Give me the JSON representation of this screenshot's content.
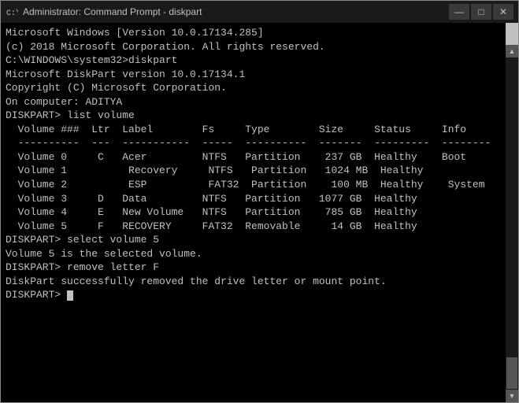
{
  "window": {
    "title": "Administrator: Command Prompt - diskpart",
    "icon": "cmd"
  },
  "titlebar": {
    "minimize_label": "—",
    "maximize_label": "□",
    "close_label": "✕"
  },
  "terminal": {
    "lines": [
      "Microsoft Windows [Version 10.0.17134.285]",
      "(c) 2018 Microsoft Corporation. All rights reserved.",
      "",
      "C:\\WINDOWS\\system32>diskpart",
      "",
      "Microsoft DiskPart version 10.0.17134.1",
      "",
      "Copyright (C) Microsoft Corporation.",
      "On computer: ADITYA",
      "",
      "DISKPART> list volume",
      "",
      "  Volume ###  Ltr  Label        Fs     Type        Size     Status     Info",
      "  ----------  ---  -----------  -----  ----------  -------  ---------  --------",
      "  Volume 0     C   Acer         NTFS   Partition    237 GB  Healthy    Boot",
      "  Volume 1          Recovery     NTFS   Partition   1024 MB  Healthy",
      "  Volume 2          ESP          FAT32  Partition    100 MB  Healthy    System",
      "  Volume 3     D   Data         NTFS   Partition   1077 GB  Healthy",
      "  Volume 4     E   New Volume   NTFS   Partition    785 GB  Healthy",
      "  Volume 5     F   RECOVERY     FAT32  Removable     14 GB  Healthy",
      "",
      "DISKPART> select volume 5",
      "",
      "Volume 5 is the selected volume.",
      "",
      "DISKPART> remove letter F",
      "",
      "DiskPart successfully removed the drive letter or mount point.",
      "",
      "DISKPART> "
    ],
    "cursor_line_index": 29
  }
}
